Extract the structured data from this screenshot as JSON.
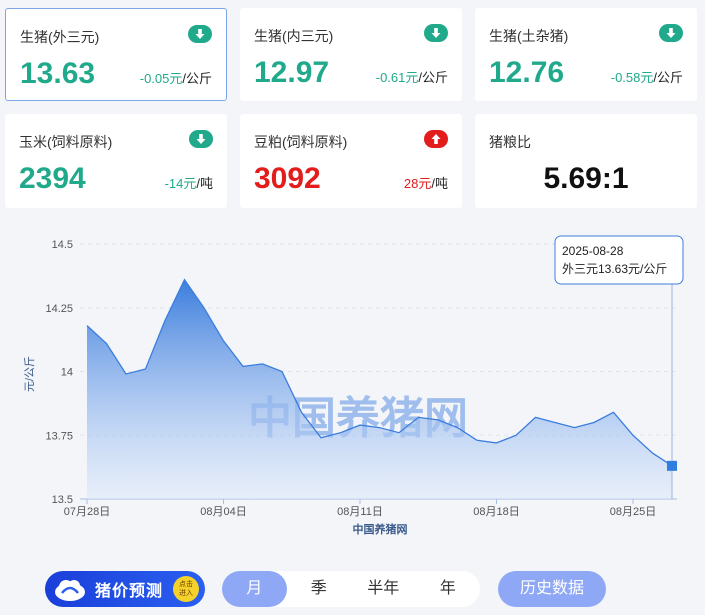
{
  "cards": [
    {
      "name": "生猪(外三元)",
      "price": "13.63",
      "change": "-0.05元",
      "unit": "/公斤",
      "dir": "down"
    },
    {
      "name": "生猪(内三元)",
      "price": "12.97",
      "change": "-0.61元",
      "unit": "/公斤",
      "dir": "down"
    },
    {
      "name": "生猪(土杂猪)",
      "price": "12.76",
      "change": "-0.58元",
      "unit": "/公斤",
      "dir": "down"
    },
    {
      "name": "玉米(饲料原料)",
      "price": "2394",
      "change": "-14元",
      "unit": "/吨",
      "dir": "down"
    },
    {
      "name": "豆粕(饲料原料)",
      "price": "3092",
      "change": "28元",
      "unit": "/吨",
      "dir": "up"
    },
    {
      "name": "猪粮比",
      "price": "5.69:1"
    }
  ],
  "colors": {
    "down": "#20a98a",
    "up": "#e31c1c",
    "line": "#3b7ddd",
    "accent": "#8ea8f6"
  },
  "chart_data": {
    "type": "area",
    "ylabel": "元/公斤",
    "xlabel": "中国养猪网",
    "watermark": "中国养猪网",
    "ylim": [
      13.5,
      14.5
    ],
    "y_ticks": [
      "14.5",
      "14.25",
      "14",
      "13.75",
      "13.5"
    ],
    "x_ticks": [
      "07月28日",
      "08月04日",
      "08月11日",
      "08月18日",
      "08月25日"
    ],
    "x": [
      "2025-07-28",
      "2025-07-29",
      "2025-07-30",
      "2025-07-31",
      "2025-08-01",
      "2025-08-02",
      "2025-08-03",
      "2025-08-04",
      "2025-08-05",
      "2025-08-06",
      "2025-08-07",
      "2025-08-08",
      "2025-08-09",
      "2025-08-10",
      "2025-08-11",
      "2025-08-12",
      "2025-08-13",
      "2025-08-14",
      "2025-08-15",
      "2025-08-16",
      "2025-08-17",
      "2025-08-18",
      "2025-08-19",
      "2025-08-20",
      "2025-08-21",
      "2025-08-22",
      "2025-08-23",
      "2025-08-24",
      "2025-08-25",
      "2025-08-26",
      "2025-08-27",
      "2025-08-28"
    ],
    "series": [
      {
        "name": "外三元",
        "values": [
          14.18,
          14.11,
          13.99,
          14.01,
          14.2,
          14.36,
          14.25,
          14.12,
          14.02,
          14.03,
          14.0,
          13.84,
          13.74,
          13.76,
          13.79,
          13.78,
          13.76,
          13.82,
          13.81,
          13.78,
          13.73,
          13.72,
          13.75,
          13.82,
          13.8,
          13.78,
          13.8,
          13.84,
          13.75,
          13.68,
          13.63
        ]
      }
    ],
    "tooltip": {
      "date": "2025-08-28",
      "text": "外三元13.63元/公斤"
    }
  },
  "controls": {
    "predict_label": "猪价预测",
    "badge": "点击进入",
    "periods": [
      "月",
      "季",
      "半年",
      "年"
    ],
    "selected": "月",
    "history_label": "历史数据"
  }
}
